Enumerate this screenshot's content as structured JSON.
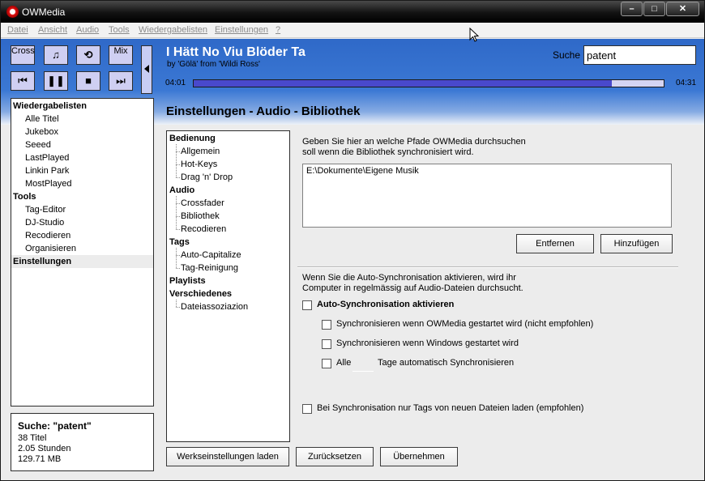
{
  "window": {
    "title": "OWMedia"
  },
  "menu": [
    "Datei",
    "Ansicht",
    "Audio",
    "Tools",
    "Wiedergabelisten",
    "Einstellungen",
    "?"
  ],
  "controls": {
    "cross": "Cross",
    "mix": "Mix"
  },
  "track": {
    "title": "I Hätt No Viu Blöder Ta",
    "subtitle": "by 'Gölä' from 'Wildi Ross'",
    "elapsed": "04:01",
    "total": "04:31",
    "progress_fraction": 0.889
  },
  "search": {
    "label": "Suche",
    "value": "patent"
  },
  "section_title": "Einstellungen - Audio - Bibliothek",
  "left_tree": [
    {
      "label": "Wiedergabelisten",
      "type": "group"
    },
    {
      "label": "Alle Titel",
      "type": "child"
    },
    {
      "label": "Jukebox",
      "type": "child"
    },
    {
      "label": "Seeed",
      "type": "child"
    },
    {
      "label": "LastPlayed",
      "type": "child"
    },
    {
      "label": "Linkin Park",
      "type": "child"
    },
    {
      "label": "MostPlayed",
      "type": "child"
    },
    {
      "label": "Tools",
      "type": "group"
    },
    {
      "label": "Tag-Editor",
      "type": "child"
    },
    {
      "label": "DJ-Studio",
      "type": "child"
    },
    {
      "label": "Recodieren",
      "type": "child"
    },
    {
      "label": "Organisieren",
      "type": "child"
    },
    {
      "label": "Einstellungen",
      "type": "group",
      "selected": true
    }
  ],
  "info": {
    "title": "Suche:  \"patent\"",
    "titles": "38 Titel",
    "duration": "2.05 Stunden",
    "size": "129.71 MB"
  },
  "settings_tree": [
    {
      "label": "Bedienung",
      "type": "group"
    },
    {
      "label": "Allgemein",
      "type": "child"
    },
    {
      "label": "Hot-Keys",
      "type": "child"
    },
    {
      "label": "Drag 'n' Drop",
      "type": "child"
    },
    {
      "label": "Audio",
      "type": "group"
    },
    {
      "label": "Crossfader",
      "type": "child"
    },
    {
      "label": "Bibliothek",
      "type": "child"
    },
    {
      "label": "Recodieren",
      "type": "child"
    },
    {
      "label": "Tags",
      "type": "group"
    },
    {
      "label": "Auto-Capitalize",
      "type": "child"
    },
    {
      "label": "Tag-Reinigung",
      "type": "child"
    },
    {
      "label": "Playlists",
      "type": "group"
    },
    {
      "label": "Verschiedenes",
      "type": "group"
    },
    {
      "label": "Dateiassoziazion",
      "type": "child"
    }
  ],
  "library": {
    "desc_line1": "Geben Sie hier an welche Pfade OWMedia durchsuchen",
    "desc_line2": "soll wenn die Bibliothek synchronisiert wird.",
    "paths": [
      "E:\\Dokumente\\Eigene Musik"
    ],
    "remove_button": "Entfernen",
    "add_button": "Hinzufügen"
  },
  "sync": {
    "desc_line1": "Wenn Sie die Auto-Synchronisation aktivieren, wird ihr",
    "desc_line2": "Computer in regelmässig auf Audio-Dateien durchsucht.",
    "auto_sync": "Auto-Synchronisation aktivieren",
    "on_owmedia": "Synchronisieren wenn OWMedia gestartet wird (nicht empfohlen)",
    "on_windows": "Synchronisieren wenn Windows gestartet wird",
    "every_prefix": "Alle",
    "every_suffix": "Tage automatisch Synchronisieren",
    "tags_only": "Bei Synchronisation nur Tags von neuen Dateien laden (empfohlen)"
  },
  "footer_buttons": {
    "defaults": "Werkseinstellungen laden",
    "reset": "Zurücksetzen",
    "apply": "Übernehmen"
  }
}
